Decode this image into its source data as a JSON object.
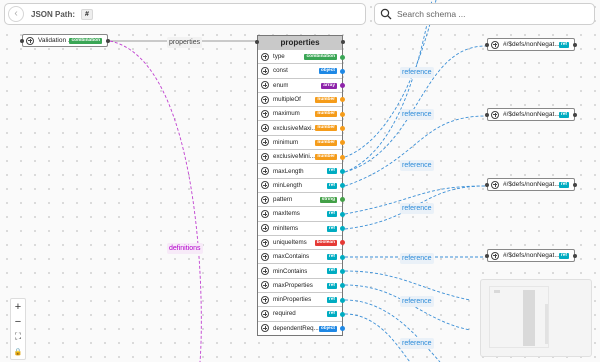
{
  "path_bar": {
    "label": "JSON Path:",
    "value": "#",
    "back_icon": "back-arrow-icon"
  },
  "search": {
    "placeholder": "Search schema ...",
    "icon": "search-icon"
  },
  "root_node": {
    "label": "Validation ...",
    "badge": "combination",
    "badge_color": "#3aa655"
  },
  "properties_node": {
    "title": "properties"
  },
  "edge_labels": {
    "properties": "properties",
    "definitions": "definitions",
    "reference": "reference"
  },
  "type_colors": {
    "combination": "#3aa655",
    "object": "#1e88e5",
    "array": "#8e24aa",
    "number": "#f59c1a",
    "ref": "#00acc1",
    "string": "#43a047",
    "boolean": "#e53935"
  },
  "properties": [
    {
      "name": "type",
      "badge": "combination",
      "color": "#3aa655"
    },
    {
      "name": "const",
      "badge": "object",
      "color": "#1e88e5"
    },
    {
      "name": "enum",
      "badge": "array",
      "color": "#8e24aa"
    },
    {
      "name": "multipleOf",
      "badge": "number",
      "color": "#f59c1a"
    },
    {
      "name": "maximum",
      "badge": "number",
      "color": "#f59c1a"
    },
    {
      "name": "exclusiveMaxi...",
      "badge": "number",
      "color": "#f59c1a"
    },
    {
      "name": "minimum",
      "badge": "number",
      "color": "#f59c1a"
    },
    {
      "name": "exclusiveMini...",
      "badge": "number",
      "color": "#f59c1a"
    },
    {
      "name": "maxLength",
      "badge": "ref",
      "color": "#00acc1"
    },
    {
      "name": "minLength",
      "badge": "ref",
      "color": "#00acc1"
    },
    {
      "name": "pattern",
      "badge": "string",
      "color": "#43a047"
    },
    {
      "name": "maxItems",
      "badge": "ref",
      "color": "#00acc1"
    },
    {
      "name": "minItems",
      "badge": "ref",
      "color": "#00acc1"
    },
    {
      "name": "uniqueItems",
      "badge": "boolean",
      "color": "#e53935"
    },
    {
      "name": "maxContains",
      "badge": "ref",
      "color": "#00acc1"
    },
    {
      "name": "minContains",
      "badge": "ref",
      "color": "#00acc1"
    },
    {
      "name": "maxProperties",
      "badge": "ref",
      "color": "#00acc1"
    },
    {
      "name": "minProperties",
      "badge": "ref",
      "color": "#00acc1"
    },
    {
      "name": "required",
      "badge": "ref",
      "color": "#00acc1"
    },
    {
      "name": "dependentReq...",
      "badge": "object",
      "color": "#1e88e5"
    }
  ],
  "ref_nodes": [
    {
      "label": "#/$defs/nonNegat...",
      "badge": "ref"
    },
    {
      "label": "#/$defs/nonNegat...",
      "badge": "ref"
    },
    {
      "label": "#/$defs/nonNegat...",
      "badge": "ref"
    },
    {
      "label": "#/$defs/nonNegat...",
      "badge": "ref"
    }
  ],
  "map_controls": [
    {
      "name": "zoom-in-button",
      "glyph": "+"
    },
    {
      "name": "zoom-out-button",
      "glyph": "−"
    },
    {
      "name": "fit-view-button",
      "glyph": "⛶"
    },
    {
      "name": "lock-button",
      "glyph": "🔒"
    }
  ]
}
